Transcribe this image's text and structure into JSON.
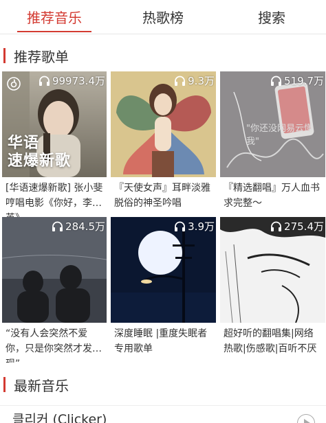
{
  "tabs": [
    {
      "label": "推荐音乐",
      "active": true
    },
    {
      "label": "热歌榜",
      "active": false
    },
    {
      "label": "搜索",
      "active": false
    }
  ],
  "sections": {
    "recommended": "推荐歌单",
    "newest": "最新音乐"
  },
  "playlists": [
    {
      "count": "99973.4万",
      "title": "[华语速爆新歌] 张小斐哼唱电影《你好，李焕英》",
      "cover_text": "华语\n速爆新歌"
    },
    {
      "count": "9.3万",
      "title": "『天使女声』耳畔淡雅脱俗的神圣吟唱"
    },
    {
      "count": "519.7万",
      "title": "『精选翻唱』万人血书求完整～",
      "cover_text": "\"你还没网易云懂我\""
    },
    {
      "count": "284.5万",
      "title": "“没有人会突然不爱你，只是你突然才发现”"
    },
    {
      "count": "3.9万",
      "title": "深度睡眠 |重度失眠者专用歌单"
    },
    {
      "count": "275.4万",
      "title": "超好听的翻唱集|网络热歌|伤感歌|百听不厌"
    }
  ],
  "songs": [
    {
      "title": "클리커 (Clicker)"
    }
  ],
  "colors": {
    "accent": "#d33a31"
  }
}
